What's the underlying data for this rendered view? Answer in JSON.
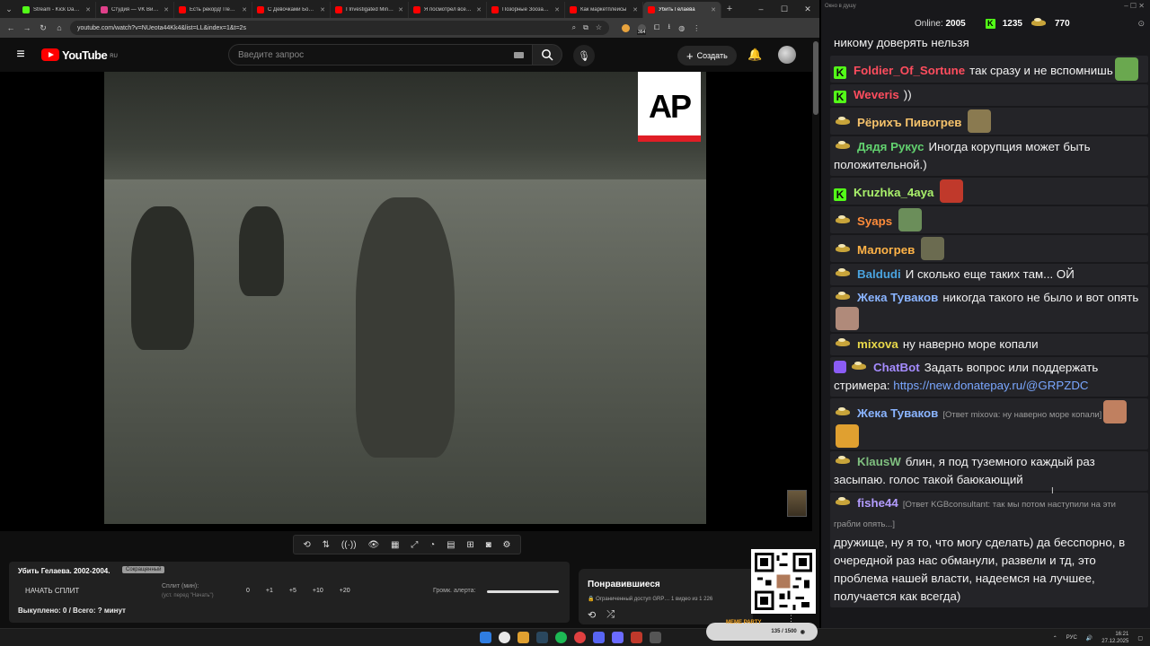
{
  "browser": {
    "tabs": [
      {
        "title": "Stream - Kick Dashbo",
        "color": "#53fc18",
        "active": false
      },
      {
        "title": "Студия — VK Видео",
        "color": "#e0408a",
        "active": false
      },
      {
        "title": "Есть рекорд! Первый",
        "color": "#ff0000",
        "active": false
      },
      {
        "title": "С Девочками Более",
        "color": "#ff0000",
        "active": false
      },
      {
        "title": "I Investigated Minecraft",
        "color": "#ff0000",
        "active": false
      },
      {
        "title": "Я посмотрел все фил",
        "color": "#ff0000",
        "active": false
      },
      {
        "title": "Позорные Зоозащи",
        "color": "#ff0000",
        "active": false
      },
      {
        "title": "Как маркетплейсы",
        "color": "#ff0000",
        "active": false
      },
      {
        "title": "Убить Гелаева",
        "color": "#ff0000",
        "active": true
      }
    ],
    "url": "youtube.com/watch?v=NUeota44Kk4&list=LL&index=1&t=2s",
    "ext_badge": "364"
  },
  "youtube": {
    "logo_text": "YouTube",
    "region": "RU",
    "search_placeholder": "Введите запрос",
    "create_label": "Создать"
  },
  "video": {
    "watermark": "AP"
  },
  "split_panel": {
    "title": "Убить Гелаева. 2002-2004.",
    "badge": "Сокращенный",
    "start_label": "НАЧАТЬ СПЛИТ",
    "split_label": "Сплит (мин):",
    "split_hint": "(уст. перед \"Начать\")",
    "increments": [
      "0",
      "+1",
      "+5",
      "+10",
      "+20"
    ],
    "volume_label": "Громк. алерта:",
    "bought": "Выкуплено: 0 / Всего: ? минут"
  },
  "playlist": {
    "title": "Понравившиеся",
    "subtitle": "Ограниченный доступ  GRP…   1 видео из 1 226"
  },
  "memeparty": {
    "tag": "MEME PARTY",
    "counter": "135 / 1500"
  },
  "tray": {
    "lang": "РУС",
    "time": "16:21",
    "date": "27.12.2025"
  },
  "chat": {
    "window_title": "Окно в душу",
    "online_label": "Online:",
    "online": "2005",
    "kick_count": "1235",
    "beer_count": "770",
    "messages": [
      {
        "text": "никому доверять нельзя"
      },
      {
        "badge": "k",
        "user": "Foldier_Of_Sortune",
        "color": "#ff4d5e",
        "text": "так сразу и не вспомнишь"
      },
      {
        "badge": "k",
        "user": "Weveris",
        "color": "#ff4d5e",
        "text": "))"
      },
      {
        "badge": "beer",
        "user": "Рёрихъ Пивогрев",
        "color": "#f5c26b",
        "text": ""
      },
      {
        "badge": "beer",
        "user": "Дядя Рукус",
        "color": "#62d26f",
        "text": "Иногда корупция может быть положительной.)"
      },
      {
        "badge": "k",
        "user": "Kruzhka_4aya",
        "color": "#a9f06b",
        "text": ""
      },
      {
        "badge": "beer",
        "user": "Syaps",
        "color": "#ff8c3a",
        "text": ""
      },
      {
        "badge": "beer",
        "user": "Малогрев",
        "color": "#ffb347",
        "text": ""
      },
      {
        "badge": "beer",
        "user": "Baldudi",
        "color": "#4aa3df",
        "text": "И сколько еще таких там... ОЙ"
      },
      {
        "badge": "beer",
        "user": "Жека Туваков",
        "color": "#8ab4ff",
        "text": "никогда такого не было и вот опять"
      },
      {
        "badge": "beer",
        "user": "mixova",
        "color": "#e8d84a",
        "text": "ну наверно море копали"
      },
      {
        "badge": "bot",
        "user": "ChatBot",
        "color": "#a58cff",
        "text": "Задать вопрос или поддержать стримера:",
        "link": "https://new.donatepay.ru/@GRPZDC"
      },
      {
        "badge": "beer",
        "user": "Жека Туваков",
        "color": "#8ab4ff",
        "reply": "[Ответ mixova: ну наверно море копали]"
      },
      {
        "badge": "beer",
        "user": "KlausW",
        "color": "#7fbf7f",
        "text": "блин, я под туземного каждый раз засыпаю. голос такой баюкающий"
      },
      {
        "badge": "beer",
        "user": "fishe44",
        "color": "#b39cff",
        "reply": "[Ответ KGBconsultant: так мы потом наступили на эти грабли опять...]",
        "text": "дружище, ну я то, что могу сделать) да бесспорно, в очередной раз нас обманули, развели и тд, это проблема нашей власти, надеемся на лучшее, получается как всегда)"
      }
    ]
  }
}
